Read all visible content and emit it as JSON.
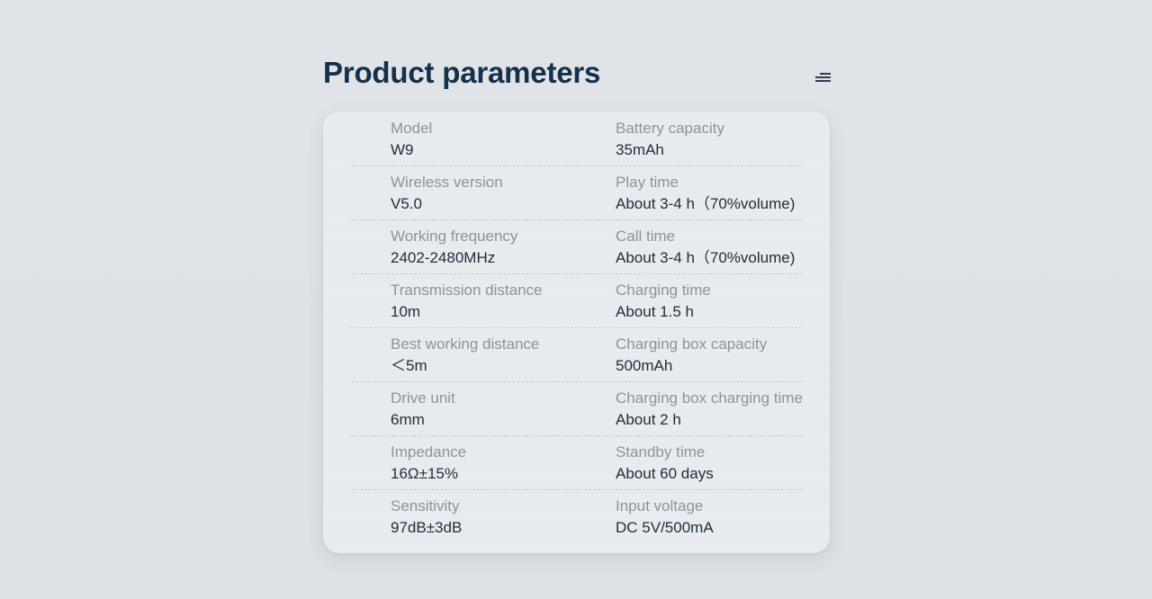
{
  "page": {
    "title": "Product parameters"
  },
  "parameters": [
    {
      "left": {
        "label": "Model",
        "value": "W9"
      },
      "right": {
        "label": "Battery capacity",
        "value": "35mAh"
      }
    },
    {
      "left": {
        "label": "Wireless version",
        "value": "V5.0"
      },
      "right": {
        "label": "Play time",
        "value": "About 3-4 h（70%volume)"
      }
    },
    {
      "left": {
        "label": "Working frequency",
        "value": "2402-2480MHz"
      },
      "right": {
        "label": "Call time",
        "value": "About 3-4 h（70%volume)"
      }
    },
    {
      "left": {
        "label": "Transmission distance",
        "value": "10m"
      },
      "right": {
        "label": "Charging time",
        "value": "About 1.5 h"
      }
    },
    {
      "left": {
        "label": "Best working distance",
        "value": "＜5m"
      },
      "right": {
        "label": "Charging box capacity",
        "value": "500mAh"
      }
    },
    {
      "left": {
        "label": "Drive unit",
        "value": "6mm"
      },
      "right": {
        "label": "Charging box charging time",
        "value": "About 2 h"
      }
    },
    {
      "left": {
        "label": "Impedance",
        "value": "16Ω±15%"
      },
      "right": {
        "label": "Standby time",
        "value": "About 60 days"
      }
    },
    {
      "left": {
        "label": "Sensitivity",
        "value": "97dB±3dB"
      },
      "right": {
        "label": "Input voltage",
        "value": "DC 5V/500mA"
      }
    }
  ],
  "icons": {
    "menu": "menu-icon"
  },
  "colors": {
    "background": "#dfe3e7",
    "card": "#e7ebee",
    "title": "#15304a",
    "label": "#8a949d",
    "value": "#1c2c3d"
  }
}
